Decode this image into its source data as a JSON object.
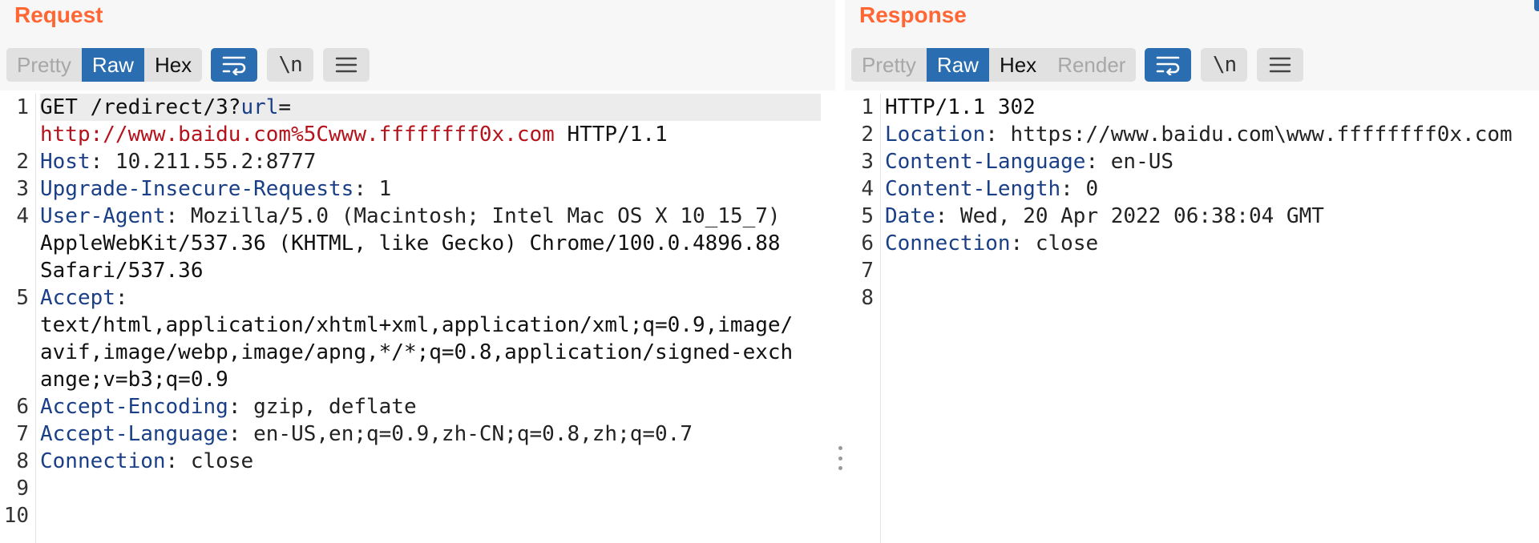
{
  "request": {
    "title": "Request",
    "tabs": [
      "Pretty",
      "Raw",
      "Hex"
    ],
    "active_tab": "Raw",
    "line_numbers": [
      "1",
      "",
      "2",
      "3",
      "4",
      "",
      "",
      "5",
      "",
      "",
      "",
      "6",
      "7",
      "8",
      "9",
      "10"
    ],
    "lines": {
      "l1a": "GET /redirect/3?",
      "l1b": "url",
      "l1c": "=",
      "l1d": "http://www.baidu.com%5Cwww.ffffffff0x.com",
      "l1e": " HTTP/1.1",
      "host_k": "Host",
      "host_v": ": 10.211.55.2:8777",
      "uir_k": "Upgrade-Insecure-Requests",
      "uir_v": ": 1",
      "ua_k": "User-Agent",
      "ua_v": ": Mozilla/5.0 (Macintosh; Intel Mac OS X 10_15_7)",
      "ua_2": "AppleWebKit/537.36 (KHTML, like Gecko) Chrome/100.0.4896.88",
      "ua_3": "Safari/537.36",
      "acc_k": "Accept",
      "acc_v": ":",
      "acc_2": "text/html,application/xhtml+xml,application/xml;q=0.9,image/",
      "acc_3": "avif,image/webp,image/apng,*/*;q=0.8,application/signed-exch",
      "acc_4": "ange;v=b3;q=0.9",
      "ae_k": "Accept-Encoding",
      "ae_v": ": gzip, deflate",
      "al_k": "Accept-Language",
      "al_v": ": en-US,en;q=0.9,zh-CN;q=0.8,zh;q=0.7",
      "conn_k": "Connection",
      "conn_v": ": close"
    }
  },
  "response": {
    "title": "Response",
    "tabs": [
      "Pretty",
      "Raw",
      "Hex",
      "Render"
    ],
    "active_tab": "Raw",
    "line_numbers": [
      "1",
      "2",
      "3",
      "4",
      "5",
      "6",
      "7",
      "8"
    ],
    "lines": {
      "status": "HTTP/1.1 302",
      "loc_k": "Location",
      "loc_v": ": https://www.baidu.com\\www.ffffffff0x.com",
      "cl_k": "Content-Language",
      "cl_v": ": en-US",
      "clen_k": "Content-Length",
      "clen_v": ": 0",
      "date_k": "Date",
      "date_v": ": Wed, 20 Apr 2022 06:38:04 GMT",
      "conn_k": "Connection",
      "conn_v": ": close"
    }
  },
  "toolbar_icons": [
    "wrap-lines-icon",
    "newline-toggle-icon",
    "menu-icon"
  ],
  "newline_label": "\\n",
  "colors": {
    "accent": "#ff6633",
    "active_tab": "#2a6eb1",
    "header_key": "#1a3f86",
    "url_value": "#b5121b"
  }
}
